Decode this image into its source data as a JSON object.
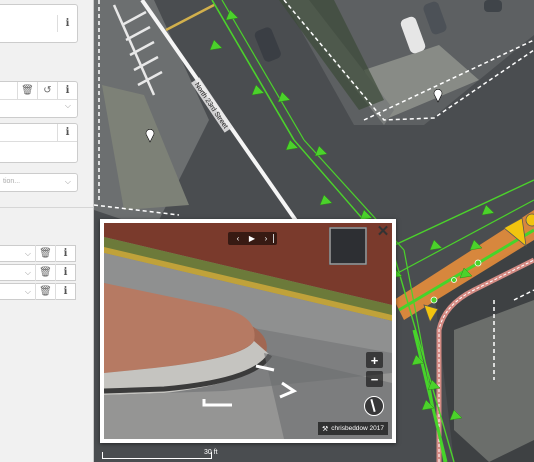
{
  "sidebar": {
    "search_placeholder": "tion...",
    "buttons": {
      "info": "i",
      "delete": "🗑",
      "undo": "↺",
      "chevron": "⌵"
    }
  },
  "map": {
    "street_label": "North 23rd Street",
    "scale_label": "30 ft"
  },
  "street_view": {
    "close_label": "✕",
    "nav_prev": "‹",
    "nav_play": "▶",
    "nav_next": "›",
    "zoom_in": "+",
    "zoom_out": "−",
    "attribution": "chrisbeddow 2017"
  },
  "colors": {
    "sidebar_bg": "#f1f1f1",
    "feature_green": "#4bd22b",
    "highlight_orange": "#f0923a",
    "marker_yellow": "#f1c40f"
  }
}
